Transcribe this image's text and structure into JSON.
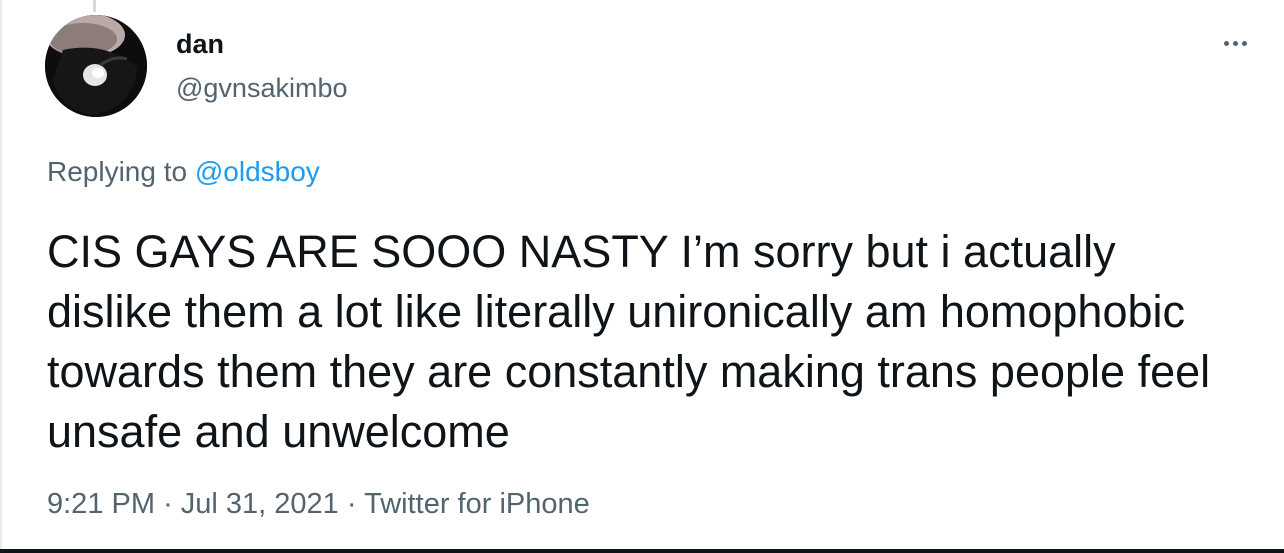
{
  "tweet": {
    "author": {
      "display_name": "dan",
      "handle": "@gvnsakimbo"
    },
    "reply": {
      "prefix": "Replying to",
      "target": "@oldsboy"
    },
    "text": "CIS GAYS ARE SOOO NASTY I’m sorry but i actually dislike them a lot like literally unironically am homophobic towards them they are constantly making trans people feel unsafe and unwelcome",
    "meta": {
      "time": "9:21 PM",
      "separator": "·",
      "date": "Jul 31, 2021",
      "source": "Twitter for iPhone"
    }
  },
  "icons": {
    "more": "more-horizontal-icon"
  },
  "colors": {
    "text": "#0f1419",
    "secondary": "#536471",
    "link": "#1d9bf0"
  }
}
